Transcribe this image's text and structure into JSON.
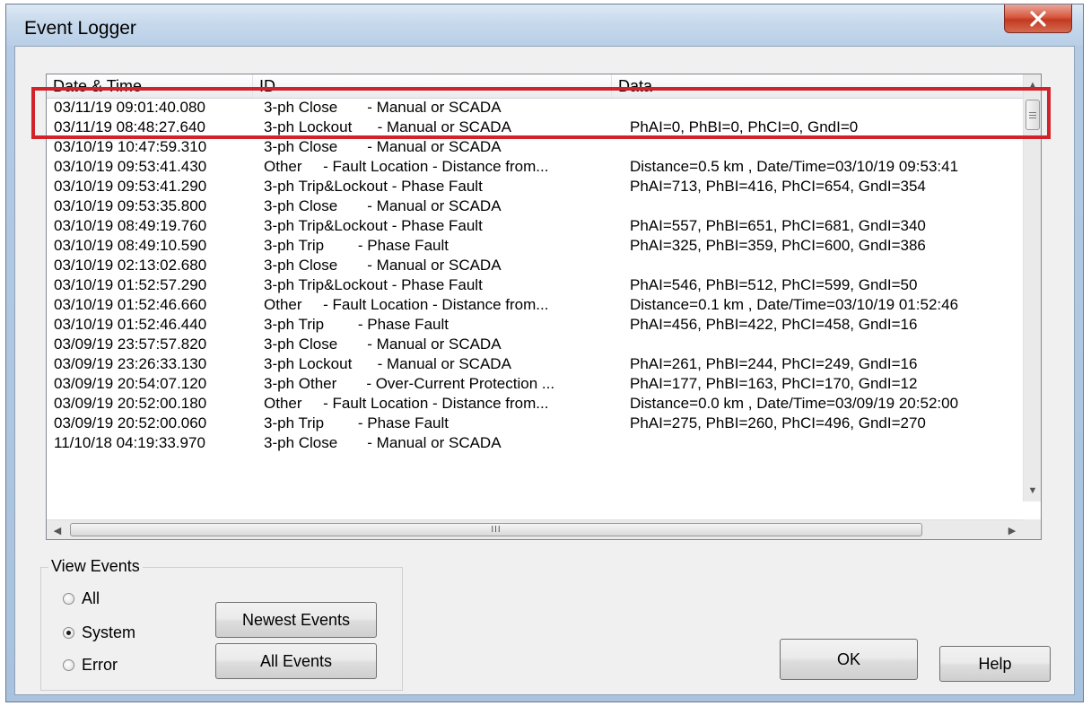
{
  "window": {
    "title": "Event Logger",
    "close_glyph": "x"
  },
  "list": {
    "columns": [
      "Date & Time",
      "ID",
      "Data"
    ],
    "rows": [
      {
        "date": "03/11/19 09:01:40.080",
        "id": "3-ph Close       - Manual or SCADA",
        "data": ""
      },
      {
        "date": "03/11/19 08:48:27.640",
        "id": "3-ph Lockout      - Manual or SCADA",
        "data": "PhAI=0, PhBI=0, PhCI=0, GndI=0"
      },
      {
        "date": "03/10/19 10:47:59.310",
        "id": "3-ph Close       - Manual or SCADA",
        "data": ""
      },
      {
        "date": "03/10/19 09:53:41.430",
        "id": "Other     - Fault Location - Distance from...",
        "data": "Distance=0.5 km , Date/Time=03/10/19 09:53:41"
      },
      {
        "date": "03/10/19 09:53:41.290",
        "id": "3-ph Trip&Lockout - Phase Fault",
        "data": "PhAI=713, PhBI=416, PhCI=654, GndI=354"
      },
      {
        "date": "03/10/19 09:53:35.800",
        "id": "3-ph Close       - Manual or SCADA",
        "data": ""
      },
      {
        "date": "03/10/19 08:49:19.760",
        "id": "3-ph Trip&Lockout - Phase Fault",
        "data": "PhAI=557, PhBI=651, PhCI=681, GndI=340"
      },
      {
        "date": "03/10/19 08:49:10.590",
        "id": "3-ph Trip        - Phase Fault",
        "data": "PhAI=325, PhBI=359, PhCI=600, GndI=386"
      },
      {
        "date": "03/10/19 02:13:02.680",
        "id": "3-ph Close       - Manual or SCADA",
        "data": ""
      },
      {
        "date": "03/10/19 01:52:57.290",
        "id": "3-ph Trip&Lockout - Phase Fault",
        "data": "PhAI=546, PhBI=512, PhCI=599, GndI=50"
      },
      {
        "date": "03/10/19 01:52:46.660",
        "id": "Other     - Fault Location - Distance from...",
        "data": "Distance=0.1 km , Date/Time=03/10/19 01:52:46"
      },
      {
        "date": "03/10/19 01:52:46.440",
        "id": "3-ph Trip        - Phase Fault",
        "data": "PhAI=456, PhBI=422, PhCI=458, GndI=16"
      },
      {
        "date": "03/09/19 23:57:57.820",
        "id": "3-ph Close       - Manual or SCADA",
        "data": ""
      },
      {
        "date": "03/09/19 23:26:33.130",
        "id": "3-ph Lockout      - Manual or SCADA",
        "data": "PhAI=261, PhBI=244, PhCI=249, GndI=16"
      },
      {
        "date": "03/09/19 20:54:07.120",
        "id": "3-ph Other       - Over-Current Protection ...",
        "data": "PhAI=177, PhBI=163, PhCI=170, GndI=12"
      },
      {
        "date": "03/09/19 20:52:00.180",
        "id": "Other     - Fault Location - Distance from...",
        "data": "Distance=0.0 km , Date/Time=03/09/19 20:52:00"
      },
      {
        "date": "03/09/19 20:52:00.060",
        "id": "3-ph Trip        - Phase Fault",
        "data": "PhAI=275, PhBI=260, PhCI=496, GndI=270"
      },
      {
        "date": "11/10/18 04:19:33.970",
        "id": "3-ph Close       - Manual or SCADA",
        "data": ""
      }
    ],
    "hscroll_thumb_glyph": "III"
  },
  "view_events": {
    "title": "View Events",
    "options": [
      {
        "label": "All",
        "checked": false
      },
      {
        "label": "System",
        "checked": true
      },
      {
        "label": "Error",
        "checked": false
      }
    ],
    "newest_events_label": "Newest Events",
    "all_events_label": "All Events"
  },
  "buttons": {
    "ok_label": "OK",
    "help_label": "Help"
  },
  "colors": {
    "highlight_border": "#d2232a",
    "close_button": "#c23b22",
    "title_bar": "#c7d9ec"
  }
}
